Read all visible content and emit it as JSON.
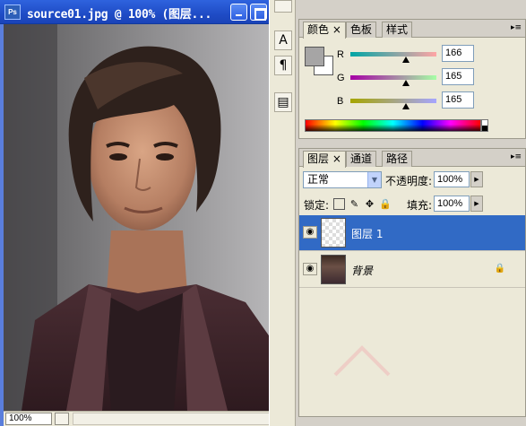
{
  "document": {
    "icon_label": "Ps",
    "title": "source01.jpg @ 100% (图层...",
    "zoom": "100%"
  },
  "toolbox": {
    "tools": [
      {
        "name": "text-tool",
        "glyph": "A"
      },
      {
        "name": "paragraph-tool",
        "glyph": "¶"
      },
      {
        "name": "notes-tool",
        "glyph": "▤"
      }
    ]
  },
  "color_panel": {
    "tabs": [
      "颜色",
      "色板",
      "样式"
    ],
    "foreground": "#a6a5a5",
    "background": "#ffffff",
    "channels": [
      {
        "label": "R",
        "value": "166",
        "fraction": 0.651
      },
      {
        "label": "G",
        "value": "165",
        "fraction": 0.647
      },
      {
        "label": "B",
        "value": "165",
        "fraction": 0.647
      }
    ]
  },
  "layers_panel": {
    "tabs": [
      "图层",
      "通道",
      "路径"
    ],
    "blend_mode": "正常",
    "opacity_label": "不透明度:",
    "opacity_value": "100%",
    "lock_label": "锁定:",
    "fill_label": "填充:",
    "fill_value": "100%",
    "layers": [
      {
        "name": "图层 1",
        "selected": true,
        "thumbnail": "transparent"
      },
      {
        "name": "背景",
        "selected": false,
        "thumbnail": "photo",
        "locked": true
      }
    ]
  },
  "colors": {
    "title_bar": "#1f4cc6",
    "selection": "#316ac5",
    "panel_bg": "#ece9d8"
  }
}
